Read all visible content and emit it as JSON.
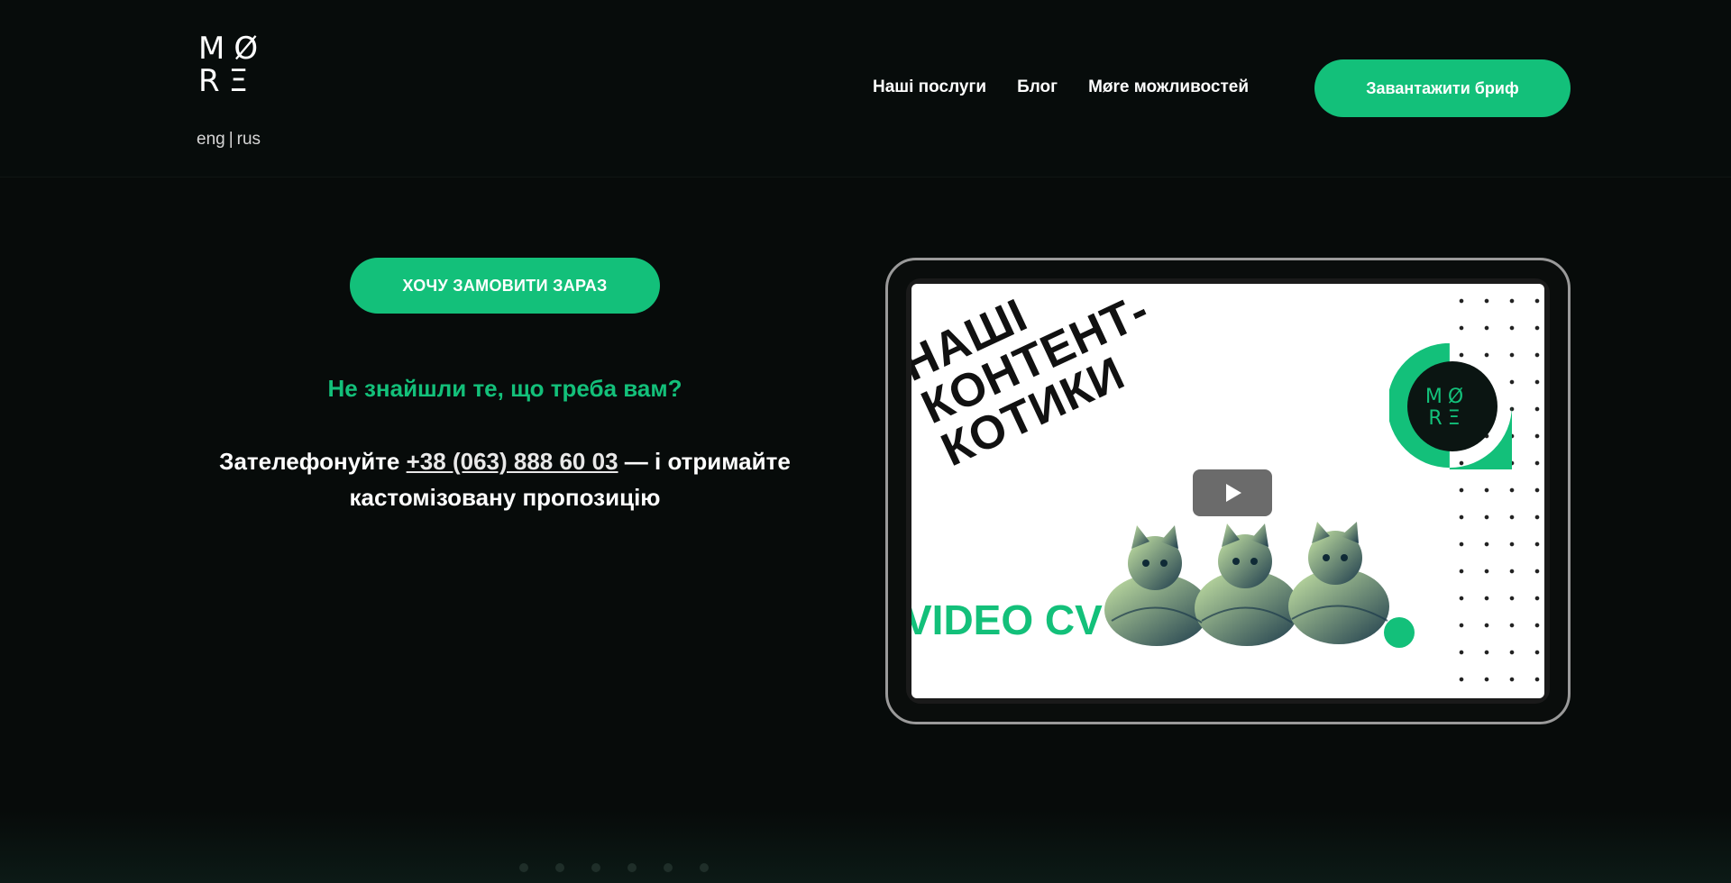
{
  "header": {
    "logo": {
      "row1": "MØ",
      "row2": "RΞ"
    },
    "languages": [
      "eng",
      "rus"
    ],
    "language_separator": "|",
    "nav": [
      {
        "label": "Наші послуги"
      },
      {
        "label": "Блог"
      },
      {
        "label": "Møre можливостей"
      }
    ],
    "brief_button": "Завантажити бриф"
  },
  "hero": {
    "order_button": "ХОЧУ ЗАМОВИТИ ЗАРАЗ",
    "not_found": "Не знайшли те, що треба вам?",
    "call_prefix": "Зателефонуйте",
    "phone": "+38 (063) 888 60 03",
    "call_suffix": "— і отримайте кастомізовану пропозицію"
  },
  "video": {
    "headline_lines": [
      "НАШІ",
      "КОНТЕНТ-",
      "КОТИКИ"
    ],
    "video_cv": "VIDEO CV",
    "badge_logo": {
      "row1": "MØ",
      "row2": "RΞ"
    }
  },
  "colors": {
    "background": "#070b0a",
    "accent": "#13c07a",
    "text": "#ffffff"
  },
  "icons": {
    "play": "play-icon"
  }
}
